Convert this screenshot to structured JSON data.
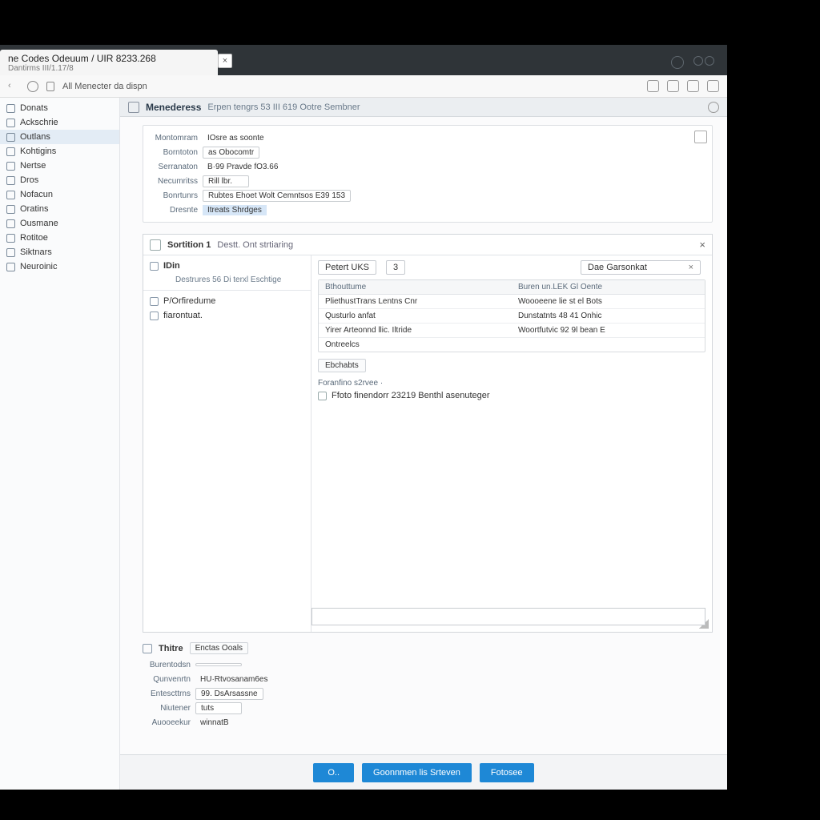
{
  "tab": {
    "title": "ne Codes Odeuum / UIR 8233.268",
    "subtitle": "Dantirms   III/1.17/8",
    "close_glyph": "×"
  },
  "url_bar": {
    "text": "All Menecter da dispn"
  },
  "sidebar": {
    "items": [
      {
        "label": "Donats",
        "selected": false
      },
      {
        "label": "Ackschrie",
        "selected": false
      },
      {
        "label": "Outlans",
        "selected": true
      },
      {
        "label": "Kohtigins",
        "selected": false
      },
      {
        "label": "Nertse",
        "selected": false
      },
      {
        "label": "Dros",
        "selected": false
      },
      {
        "label": "Nofacun",
        "selected": false
      },
      {
        "label": "Oratins",
        "selected": false
      },
      {
        "label": "Ousmane",
        "selected": false
      },
      {
        "label": "Rotitoe",
        "selected": false
      },
      {
        "label": "Siktnars",
        "selected": false
      },
      {
        "label": "Neuroinic",
        "selected": false
      }
    ]
  },
  "breadcrumb": {
    "title": "Menederess",
    "path": "Erpen tengrs 53 III 619  Ootre Sembner"
  },
  "form_top": {
    "rows": [
      {
        "label": "Montomram",
        "value": "IOsre as soonte"
      },
      {
        "label": "Borntoton",
        "value": "as Obocomtr",
        "boxed": true
      },
      {
        "label": "Serranaton",
        "value": "B·99 Pravde fO3.66"
      },
      {
        "label": "Necumritss",
        "value": "Rill lbr.",
        "boxed": true
      },
      {
        "label": "Bonrtunrs",
        "value": "Rubtes Ehoet Wolt Cemntsos E39 153",
        "boxed": true
      },
      {
        "label": "Dresnte",
        "value": "Itreats Shrdges",
        "highlight": true
      }
    ]
  },
  "detail": {
    "header": {
      "title": "Sortition 1",
      "sub": "Destt. Ont strtiaring",
      "close": "×"
    },
    "left": {
      "head": "IDin",
      "head_sub": "Destrures 56 Di terxl Eschtige",
      "items": [
        "P/Orfiredume",
        "fiarontuat."
      ]
    },
    "right": {
      "pill_a": "Petert UKS",
      "pill_a_tag": "3",
      "pill_b": "Dae Garsonkat",
      "prop_head_a": "Bthouttume",
      "prop_head_b": "Buren un.LEK Gl Oente",
      "props": [
        {
          "a": "PliethustTrans Lentns Cnr",
          "b": "Woooeene lie st el Bots"
        },
        {
          "a": "Qusturlo anfat",
          "b": "Dunstatnts 48 41 Onhic"
        },
        {
          "a": "Yirer Arteonnd llic. Iltride",
          "b": "Woortfutvic 92 9l bean E"
        },
        {
          "a": "Ontreelcs",
          "b": ""
        }
      ],
      "chip": "Ebchabts",
      "subhead": "Foranfino s2rvee ·",
      "checkbox_label": "Ffoto finendorr 23219 Benthl asenuteger"
    }
  },
  "form_bottom": {
    "title": "Thitre",
    "tag": "Enctas Ooals",
    "rows": [
      {
        "label": "Burentodsn",
        "value": "",
        "boxed": true
      },
      {
        "label": "Qunvenrtn",
        "value": "HU·Rtvosanam6es"
      },
      {
        "label": "Entescttrns",
        "value": "99. DsArsassne",
        "boxed": true
      },
      {
        "label": "Niutener",
        "value": "tuts",
        "boxed": true
      },
      {
        "label": "Auooeekur",
        "value": "winnatB"
      }
    ]
  },
  "footer": {
    "ok": "O..",
    "mid": "Goonnmen lis Srteven",
    "right": "Fotosee"
  }
}
